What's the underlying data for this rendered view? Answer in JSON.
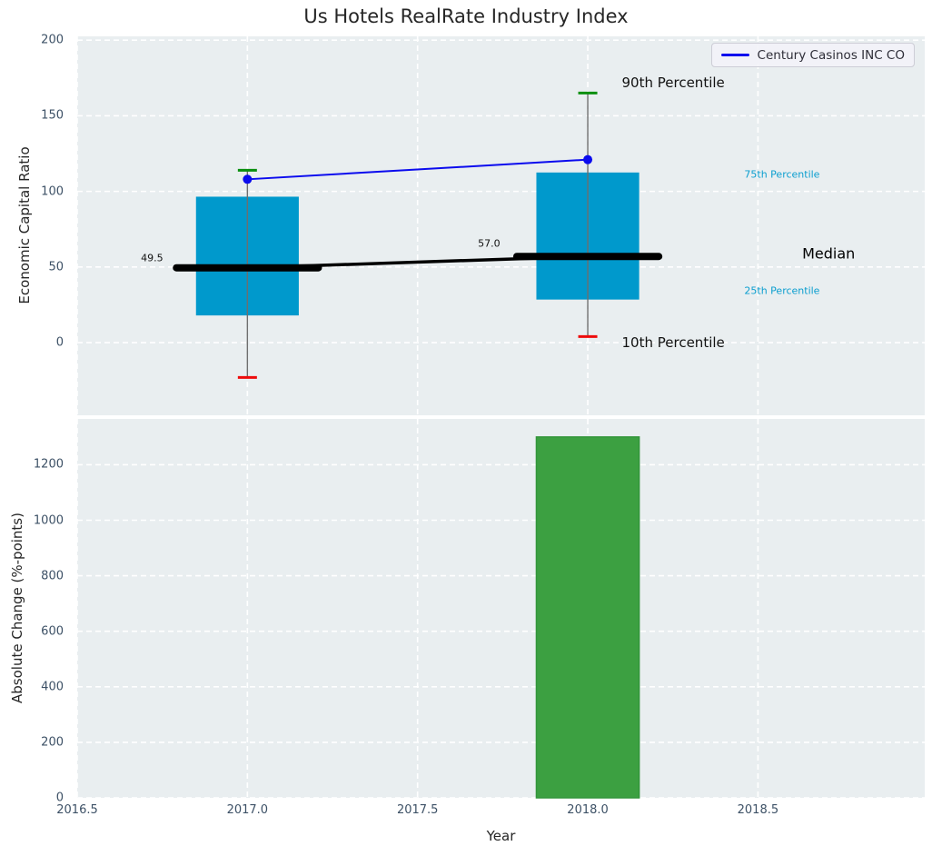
{
  "title": "Us Hotels RealRate Industry Index",
  "legend": {
    "label": "Century Casinos INC CO"
  },
  "colors": {
    "axes_bg": "#e9eef0",
    "grid": "#ffffff",
    "box_fill": "#0099cc",
    "median": "#000000",
    "whisker": "#6e6e6e",
    "cap_top": "#0a8f0f",
    "cap_bottom": "#ee0b0b",
    "line": "#0b0bee",
    "bar_fill": "#3ca041",
    "bar_edge": "#32953a",
    "annotation_cyan": "#0b9ecf"
  },
  "x_axis": {
    "label": "Year",
    "xlim": [
      2016.5,
      2018.99
    ],
    "ticks": [
      2016.5,
      2017.0,
      2017.5,
      2018.0,
      2018.5
    ]
  },
  "chart_data": [
    {
      "type": "boxplot+line",
      "ylabel": "Economic Capital Ratio",
      "ylim": [
        -48,
        202.5
      ],
      "yticks": [
        0,
        50,
        100,
        150,
        200
      ],
      "box_width": 0.302,
      "median_bar_width": 0.417,
      "percentiles": [
        {
          "x": 2017,
          "p90": 114,
          "p75": 96.5,
          "median": 49.5,
          "p25": 18,
          "p10": -23
        },
        {
          "x": 2018,
          "p90": 165,
          "p75": 112.5,
          "median": 57.0,
          "p25": 28.5,
          "p10": 4
        }
      ],
      "line_series": {
        "name": "Century Casinos INC CO",
        "x": [
          2017,
          2018
        ],
        "y": [
          108,
          121
        ]
      },
      "annotations": [
        {
          "text": "90th Percentile",
          "x": 2018.1,
          "y": 172,
          "kind": "callout",
          "anchor": "start"
        },
        {
          "text": "10th Percentile",
          "x": 2018.1,
          "y": 0,
          "kind": "callout",
          "anchor": "start"
        },
        {
          "text": "75th Percentile",
          "x": 2018.46,
          "y": 111,
          "kind": "cyan",
          "anchor": "start"
        },
        {
          "text": "25th Percentile",
          "x": 2018.46,
          "y": 34,
          "kind": "cyan",
          "anchor": "start"
        },
        {
          "text": "Median",
          "x": 2018.63,
          "y": 59,
          "kind": "median",
          "anchor": "start"
        },
        {
          "text": "49.5",
          "x": 2016.72,
          "y": 56,
          "kind": "value",
          "anchor": "middle"
        },
        {
          "text": "57.0",
          "x": 2017.71,
          "y": 65.5,
          "kind": "value",
          "anchor": "middle"
        }
      ]
    },
    {
      "type": "bar",
      "ylabel": "Absolute Change (%-points)",
      "ylim": [
        0,
        1365
      ],
      "yticks": [
        0,
        200,
        400,
        600,
        800,
        1000,
        1200
      ],
      "bar_width": 0.302,
      "bars": [
        {
          "x": 2018,
          "value": 1300
        }
      ]
    }
  ]
}
